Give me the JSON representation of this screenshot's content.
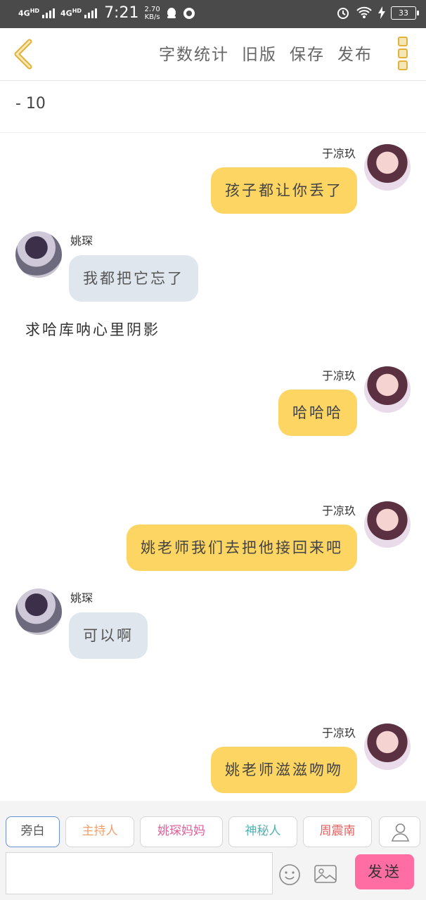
{
  "status_bar": {
    "network_1": "4G",
    "network_1_sup": "HD",
    "network_2": "4G",
    "network_2_sup": "HD",
    "time": "7:21",
    "speed_value": "2.70",
    "speed_unit": "KB/s",
    "battery": "33"
  },
  "toolbar": {
    "word_count": "字数统计",
    "old_version": "旧版",
    "save": "保存",
    "publish": "发布"
  },
  "title": "- 10",
  "messages": [
    {
      "speaker": "于凉玖",
      "text": "孩子都让你丢了"
    },
    {
      "speaker": "姚琛",
      "text": "我都把它忘了"
    },
    {
      "narration": "求哈库呐心里阴影"
    },
    {
      "speaker": "于凉玖",
      "text": "哈哈哈"
    },
    {
      "speaker": "于凉玖",
      "text": "姚老师我们去把他接回来吧"
    },
    {
      "speaker": "姚琛",
      "text": "可以啊"
    },
    {
      "speaker": "于凉玖",
      "text": "姚老师滋滋吻吻"
    }
  ],
  "roles": [
    {
      "label": "旁白",
      "color": "#555555"
    },
    {
      "label": "主持人",
      "color": "#f0a070"
    },
    {
      "label": "姚琛妈妈",
      "color": "#e0609a"
    },
    {
      "label": "神秘人",
      "color": "#4fb3b3"
    },
    {
      "label": "周震南",
      "color": "#e06060"
    }
  ],
  "input": {
    "placeholder": ""
  },
  "send_label": "发送"
}
